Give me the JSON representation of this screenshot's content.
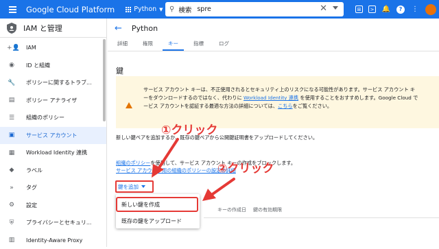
{
  "topbar": {
    "brand": "Google Cloud Platform",
    "project": "Python",
    "search_label": "検索",
    "search_value": "spre",
    "icons": [
      "menu-icon",
      "apps-icon",
      "cloud-shell-icon",
      "notifications-icon",
      "help-icon",
      "more-icon",
      "avatar"
    ]
  },
  "sidebar": {
    "title": "IAM と管理",
    "items": [
      {
        "label": "IAM",
        "icon": "person-add-icon"
      },
      {
        "label": "ID と組織",
        "icon": "account-icon"
      },
      {
        "label": "ポリシーに関するトラブ...",
        "icon": "wrench-icon"
      },
      {
        "label": "ポリシー アナライザ",
        "icon": "document-search-icon"
      },
      {
        "label": "組織のポリシー",
        "icon": "list-icon"
      },
      {
        "label": "サービス アカウント",
        "icon": "service-account-icon",
        "active": true
      },
      {
        "label": "Workload Identity 連携",
        "icon": "workload-icon"
      },
      {
        "label": "ラベル",
        "icon": "label-icon"
      },
      {
        "label": "タグ",
        "icon": "tag-icon"
      },
      {
        "label": "設定",
        "icon": "gear-icon"
      },
      {
        "label": "プライバシーとセキュリ...",
        "icon": "shield-icon"
      },
      {
        "label": "Identity-Aware Proxy",
        "icon": "proxy-icon"
      }
    ]
  },
  "main": {
    "title": "Python",
    "tabs": [
      {
        "label": "詳細"
      },
      {
        "label": "権限"
      },
      {
        "label": "キー",
        "active": true
      },
      {
        "label": "指標"
      },
      {
        "label": "ログ"
      }
    ],
    "heading": "鍵",
    "warning": {
      "line1": "サービス アカウント キーは、不正使用されるとセキュリティ上のリスクになる可能性があります。サービス アカウント キ",
      "line2_pre": "ーをダウンロードするのではなく、代わりに ",
      "line2_link": "Workload Identity 連携",
      "line2_post": " を使用することをおすすめします。Google Cloud で",
      "line3_pre": "ービス アカウントを認証する最適な方法の詳細については、",
      "line3_link": "こちら",
      "line3_post": "をご覧ください。"
    },
    "description": "新しい鍵ペアを追加するか、既存の鍵ペアから公開鍵証明書をアップロードしてください。",
    "policy": {
      "link1": "組織のポリシー",
      "text1": "を使用して、サービス アカウント キーの作成をブロックします。",
      "link2": "サービス アカウント用の組織のポリシーの設定の詳細"
    },
    "add_key": "鍵を追加",
    "menu": [
      "新しい鍵を作成",
      "既存の鍵をアップロード"
    ],
    "table_headers": [
      "キーの作成日",
      "鍵の有効期限"
    ]
  },
  "annotations": {
    "step1": "①クリック",
    "step2": "②クリック"
  },
  "colors": {
    "brand_blue": "#1a73e8",
    "annotation_red": "#e53935",
    "warning_bg": "#fef7e0"
  }
}
